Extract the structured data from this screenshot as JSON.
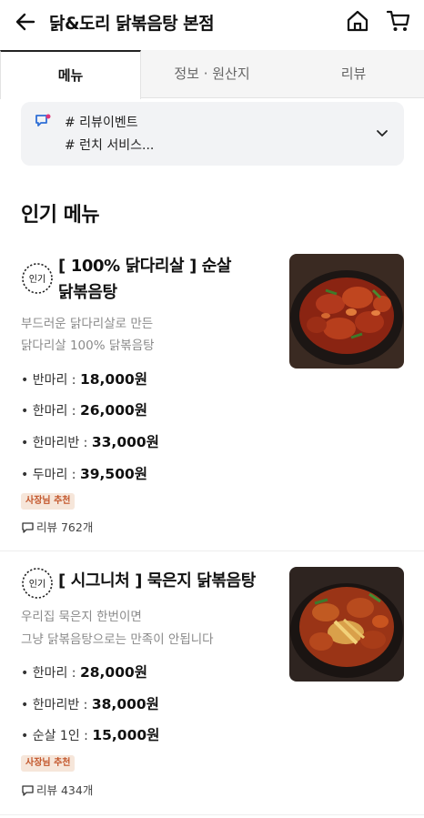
{
  "header": {
    "title": "닭&도리 닭볶음탕 본점",
    "back_icon": "back-arrow-icon",
    "home_icon": "home-icon",
    "cart_icon": "cart-icon"
  },
  "tabs": [
    {
      "label": "메뉴",
      "active": true
    },
    {
      "label": "정보 · 원산지",
      "active": false
    },
    {
      "label": "리뷰",
      "active": false
    }
  ],
  "notice": {
    "icon": "announcement-icon",
    "line1": "# 리뷰이벤트",
    "line2": "# 런치 서비스...",
    "chevron_icon": "chevron-down-icon"
  },
  "section_title": "인기 메뉴",
  "menu_items": [
    {
      "badge": "인기",
      "name_line1": "[ 100% 닭다리살 ] 순살",
      "name_line2": "닭볶음탕",
      "desc_line1": "부드러운 닭다리살로 만든",
      "desc_line2": "닭다리살 100% 닭볶음탕",
      "prices": [
        {
          "label": "• 반마리 : ",
          "value": "18,000원"
        },
        {
          "label": "• 한마리 : ",
          "value": "26,000원"
        },
        {
          "label": "• 한마리반 : ",
          "value": "33,000원"
        },
        {
          "label": "• 두마리 : ",
          "value": "39,500원"
        }
      ],
      "recommend": "사장님 추천",
      "review": "리뷰 762개"
    },
    {
      "badge": "인기",
      "name_line1": "[ 시그니처 ] 묵은지 닭볶음탕",
      "desc_line1": "우리집 묵은지 한번이면",
      "desc_line2": "그냥 닭볶음탕으로는 만족이 안됩니다",
      "prices": [
        {
          "label": "• 한마리 : ",
          "value": "28,000원"
        },
        {
          "label": "• 한마리반 : ",
          "value": "38,000원"
        },
        {
          "label": "• 순살 1인 : ",
          "value": "15,000원"
        }
      ],
      "recommend": "사장님 추천",
      "review": "리뷰 434개"
    }
  ],
  "colors": {
    "accent": "#c3562b",
    "badge_bg": "#f6e6da",
    "notice_bg": "#f2f3f5"
  }
}
